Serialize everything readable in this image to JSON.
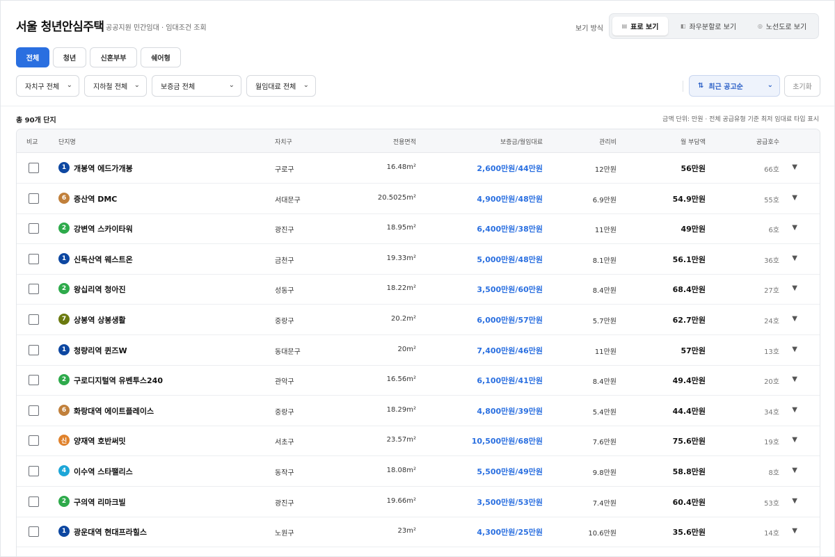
{
  "header": {
    "title": "서울 청년안심주택",
    "subtitle": "공공지원 민간임대 · 임대조건 조회",
    "view_label": "보기 방식",
    "view_modes": [
      {
        "label": "표로 보기",
        "icon": "table-icon",
        "active": true
      },
      {
        "label": "좌우분할로 보기",
        "icon": "split-view-icon",
        "active": false
      },
      {
        "label": "노선도로 보기",
        "icon": "subway-map-icon",
        "active": false
      }
    ]
  },
  "filter_tabs": [
    {
      "label": "전체",
      "active": true
    },
    {
      "label": "청년",
      "active": false
    },
    {
      "label": "신혼부부",
      "active": false
    },
    {
      "label": "쉐어형",
      "active": false
    }
  ],
  "selects": {
    "district": "자치구 전체",
    "subway": "지하철 전체",
    "deposit": "보증금 전체",
    "rent": "월임대료 전체",
    "sort": "최근 공고순",
    "reset": "초기화"
  },
  "summary": {
    "total": "총 90개 단지",
    "unit_note": "금액 단위: 만원 · 전체 공급유형 기준 최저 임대료 타입 표시"
  },
  "table": {
    "headers": {
      "compare": "비교",
      "name": "단지명",
      "district": "자치구",
      "area": "전용면적",
      "price": "보증금/월임대료",
      "mgmt": "관리비",
      "burden": "월 부담액",
      "units": "공급호수"
    },
    "line_colors": {
      "1": "#0d47a1",
      "2": "#2eaa4b",
      "4": "#1da6d8",
      "6": "#c1803b",
      "7": "#6b7a0f",
      "sinbundang": "#e0822c"
    },
    "rows": [
      {
        "line": "1",
        "line_color": "#0d47a1",
        "name": "개봉역 에드가개봉",
        "district": "구로구",
        "area": "16.48m²",
        "price": "2,600만원/44만원",
        "mgmt": "12만원",
        "burden": "56만원",
        "units": "66호"
      },
      {
        "line": "6",
        "line_color": "#c1803b",
        "name": "증산역 DMC",
        "district": "서대문구",
        "area": "20.5025m²",
        "price": "4,900만원/48만원",
        "mgmt": "6.9만원",
        "burden": "54.9만원",
        "units": "55호"
      },
      {
        "line": "2",
        "line_color": "#2eaa4b",
        "name": "강변역 스카이타워",
        "district": "광진구",
        "area": "18.95m²",
        "price": "6,400만원/38만원",
        "mgmt": "11만원",
        "burden": "49만원",
        "units": "6호"
      },
      {
        "line": "1",
        "line_color": "#0d47a1",
        "name": "신독산역 웨스트온",
        "district": "금천구",
        "area": "19.33m²",
        "price": "5,000만원/48만원",
        "mgmt": "8.1만원",
        "burden": "56.1만원",
        "units": "36호"
      },
      {
        "line": "2",
        "line_color": "#2eaa4b",
        "name": "왕십리역 청아진",
        "district": "성동구",
        "area": "18.22m²",
        "price": "3,500만원/60만원",
        "mgmt": "8.4만원",
        "burden": "68.4만원",
        "units": "27호"
      },
      {
        "line": "7",
        "line_color": "#6b7a0f",
        "name": "상봉역 상봉생활",
        "district": "중랑구",
        "area": "20.2m²",
        "price": "6,000만원/57만원",
        "mgmt": "5.7만원",
        "burden": "62.7만원",
        "units": "24호"
      },
      {
        "line": "1",
        "line_color": "#0d47a1",
        "name": "청량리역 퀸즈W",
        "district": "동대문구",
        "area": "20m²",
        "price": "7,400만원/46만원",
        "mgmt": "11만원",
        "burden": "57만원",
        "units": "13호"
      },
      {
        "line": "2",
        "line_color": "#2eaa4b",
        "name": "구로디지털역 유벤투스240",
        "district": "관악구",
        "area": "16.56m²",
        "price": "6,100만원/41만원",
        "mgmt": "8.4만원",
        "burden": "49.4만원",
        "units": "20호"
      },
      {
        "line": "6",
        "line_color": "#c1803b",
        "name": "화랑대역 에이트플레이스",
        "district": "중랑구",
        "area": "18.29m²",
        "price": "4,800만원/39만원",
        "mgmt": "5.4만원",
        "burden": "44.4만원",
        "units": "34호"
      },
      {
        "line": "신",
        "line_color": "#e0822c",
        "name": "양재역 호반써밋",
        "district": "서초구",
        "area": "23.57m²",
        "price": "10,500만원/68만원",
        "mgmt": "7.6만원",
        "burden": "75.6만원",
        "units": "19호"
      },
      {
        "line": "4",
        "line_color": "#1da6d8",
        "name": "이수역 스타팰리스",
        "district": "동작구",
        "area": "18.08m²",
        "price": "5,500만원/49만원",
        "mgmt": "9.8만원",
        "burden": "58.8만원",
        "units": "8호"
      },
      {
        "line": "2",
        "line_color": "#2eaa4b",
        "name": "구의역 리마크빌",
        "district": "광진구",
        "area": "19.66m²",
        "price": "3,500만원/53만원",
        "mgmt": "7.4만원",
        "burden": "60.4만원",
        "units": "53호"
      },
      {
        "line": "1",
        "line_color": "#0d47a1",
        "name": "광운대역 현대프라힐스",
        "district": "노원구",
        "area": "23m²",
        "price": "4,300만원/25만원",
        "mgmt": "10.6만원",
        "burden": "35.6만원",
        "units": "14호"
      }
    ]
  }
}
